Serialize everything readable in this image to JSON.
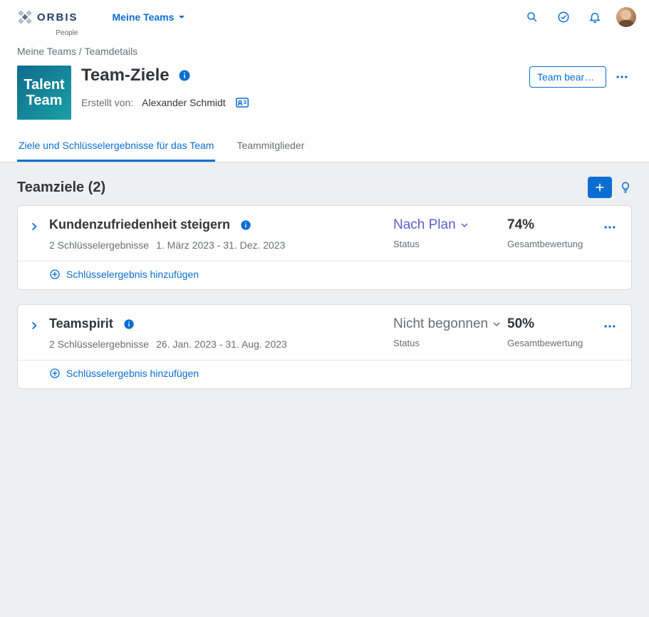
{
  "logo": {
    "brand": "ORBIS",
    "sub": "People"
  },
  "nav": {
    "my_teams": "Meine Teams"
  },
  "breadcrumb": {
    "root": "Meine Teams",
    "sep": "/",
    "current": "Teamdetails"
  },
  "team_avatar": {
    "line1": "Talent",
    "line2": "Team"
  },
  "page": {
    "title": "Team-Ziele",
    "creator_label": "Erstellt von:",
    "creator_name": "Alexander Schmidt",
    "edit_button": "Team bearbei..."
  },
  "tabs": {
    "t1": "Ziele und Schlüsselergebnisse für das Team",
    "t2": "Teammitglieder"
  },
  "section": {
    "title": "Teamziele (2)"
  },
  "labels": {
    "status": "Status",
    "overall": "Gesamtbewertung",
    "add_kr": "Schlüsselergebnis hinzufügen"
  },
  "goals": {
    "g1": {
      "title": "Kundenzufriedenheit steigern",
      "kr_count": "2 Schlüsselergebnisse",
      "daterange": "1. März 2023 - 31. Dez. 2023",
      "status": "Nach Plan",
      "score": "74%"
    },
    "g2": {
      "title": "Teamspirit",
      "kr_count": "2 Schlüsselergebnisse",
      "daterange": "26. Jan. 2023 - 31. Aug. 2023",
      "status": "Nicht begonnen",
      "score": "50%"
    }
  }
}
